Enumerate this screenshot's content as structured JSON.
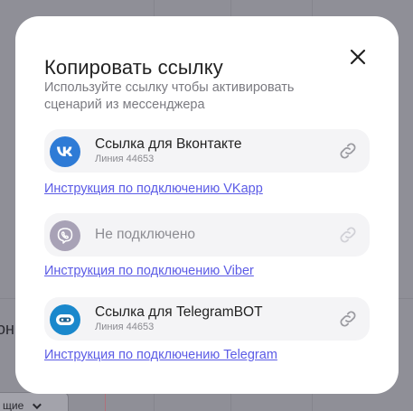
{
  "background": {
    "side_text": "он",
    "select_value": "щие"
  },
  "modal": {
    "title": "Копировать ссылку",
    "subtitle": "Используйте ссылку чтобы активировать сценарий из мессенджера",
    "close_icon": "close-icon"
  },
  "integrations": [
    {
      "icon": "vk-icon",
      "title": "Ссылка для Вконтакте",
      "line": "Линия 44653",
      "instruction": "Инструкция по подключению VKapp",
      "connected": true
    },
    {
      "icon": "viber-icon",
      "title": "Не подключено",
      "line": "",
      "instruction": "Инструкция по подключению Viber",
      "connected": false
    },
    {
      "icon": "telegram-bot-icon",
      "title": "Ссылка для TelegramBOT",
      "line": "Линия 44653",
      "instruction": "Инструкция по подключению Telegram",
      "connected": true
    }
  ],
  "colors": {
    "link": "#5b5be6",
    "vk": "#2e7bd6",
    "viber_disabled": "#a8a2b6",
    "telegram": "#1a88cc"
  }
}
